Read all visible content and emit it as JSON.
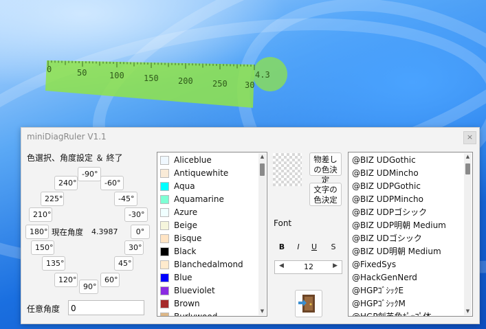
{
  "ruler": {
    "labels": [
      "0",
      "50",
      "100",
      "150",
      "200",
      "250",
      "30"
    ],
    "angle_readout": "4.3",
    "color": "#8fe34a"
  },
  "window": {
    "title": "miniDiagRuler V1.1",
    "close_glyph": "×"
  },
  "angle_panel": {
    "heading": "色選択、角度設定 ＆ 終了",
    "current_angle_label": "現在角度",
    "current_angle_value": "4.3987",
    "buttons": [
      "-90°",
      "240°",
      "-60°",
      "225°",
      "-45°",
      "210°",
      "-30°",
      "180°",
      "0°",
      "150°",
      "30°",
      "135°",
      "45°",
      "120°",
      "60°",
      "90°"
    ],
    "arbitrary_label": "任意角度",
    "arbitrary_value": "0"
  },
  "colors": {
    "items": [
      {
        "name": "Aliceblue",
        "hex": "#F0F8FF"
      },
      {
        "name": "Antiquewhite",
        "hex": "#FAEBD7"
      },
      {
        "name": "Aqua",
        "hex": "#00FFFF"
      },
      {
        "name": "Aquamarine",
        "hex": "#7FFFD4"
      },
      {
        "name": "Azure",
        "hex": "#F0FFFF"
      },
      {
        "name": "Beige",
        "hex": "#F5F5DC"
      },
      {
        "name": "Bisque",
        "hex": "#FFE4C4"
      },
      {
        "name": "Black",
        "hex": "#000000"
      },
      {
        "name": "Blanchedalmond",
        "hex": "#FFEBCD"
      },
      {
        "name": "Blue",
        "hex": "#0000FF"
      },
      {
        "name": "Blueviolet",
        "hex": "#8A2BE2"
      },
      {
        "name": "Brown",
        "hex": "#A52A2A"
      },
      {
        "name": "Burlywood",
        "hex": "#DEB887"
      }
    ]
  },
  "middle": {
    "diff_color_button": "物差しの色決定",
    "text_color_button": "文字の色決定",
    "font_label": "Font",
    "bold": "B",
    "italic": "I",
    "underline": "U",
    "strike": "S",
    "font_size": "12",
    "stepper_left": "◀",
    "stepper_right": "▶"
  },
  "fonts": {
    "items": [
      "@BIZ UDGothic",
      "@BIZ UDMincho",
      "@BIZ UDPGothic",
      "@BIZ UDPMincho",
      "@BIZ UDPゴシック",
      "@BIZ UDP明朝 Medium",
      "@BIZ UDゴシック",
      "@BIZ UD明朝 Medium",
      "@FixedSys",
      "@HackGenNerd",
      "@HGPｺﾞｼｯｸE",
      "@HGPｺﾞｼｯｸM",
      "@HGP創英角ﾎﾟｯﾌﾟ体"
    ]
  }
}
